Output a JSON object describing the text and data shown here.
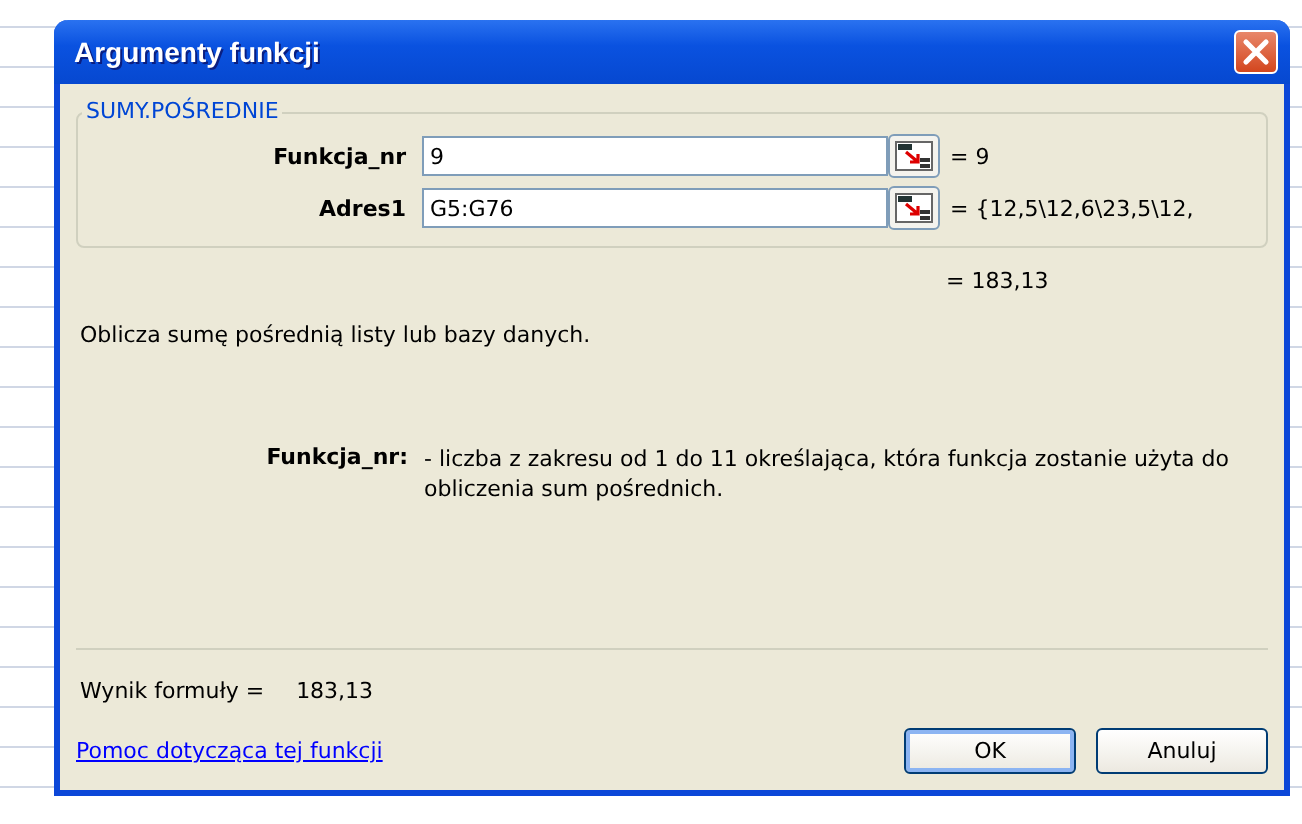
{
  "window": {
    "title": "Argumenty funkcji"
  },
  "function_name": "SUMY.POŚREDNIE",
  "arguments": [
    {
      "label": "Funkcja_nr",
      "value": "9",
      "result": "= 9"
    },
    {
      "label": "Adres1",
      "value": "G5:G76",
      "result": "= {12,5\\12,6\\23,5\\12,"
    }
  ],
  "total_result": "= 183,13",
  "description": "Oblicza sumę pośrednią listy lub bazy danych.",
  "arg_help": {
    "label": "Funkcja_nr:",
    "text": "- liczba z zakresu od 1 do 11 określająca, która funkcja zostanie użyta do obliczenia sum pośrednich."
  },
  "formula_result": {
    "label": "Wynik formuły =",
    "value": "183,13"
  },
  "help_link": "Pomoc dotycząca tej funkcji",
  "buttons": [
    {
      "label": "OK",
      "default": true
    },
    {
      "label": "Anuluj",
      "default": false
    }
  ]
}
